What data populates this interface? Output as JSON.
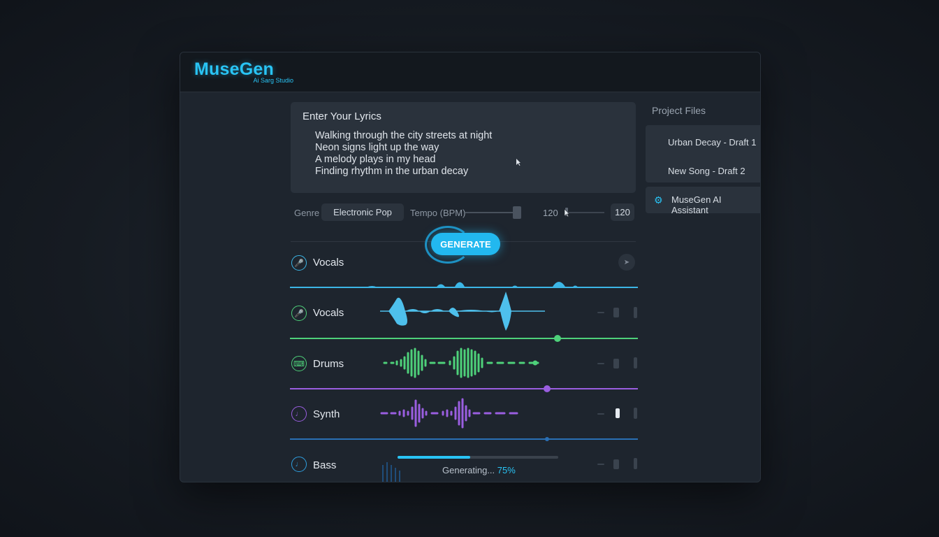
{
  "app": {
    "name": "MuseGen",
    "subtitle": "Ai Sarg Studio"
  },
  "lyrics": {
    "title": "Enter Your Lyrics",
    "lines": [
      "Walking through the city streets at night",
      "Neon signs light up the way",
      "A melody plays in my head",
      "Finding rhythm in the urban decay"
    ]
  },
  "controls": {
    "genre_label": "Genre",
    "genre_value": "Electronic Pop",
    "tempo_label": "Tempo (BPM)",
    "tempo_value": "120",
    "tempo_box": "120",
    "generate_label": "GENERATE"
  },
  "tracks": [
    {
      "name": "Vocals",
      "icon": "microphone-icon",
      "color": "#3cb6e6"
    },
    {
      "name": "Vocals",
      "icon": "microphone-icon",
      "color": "#4ed17a"
    },
    {
      "name": "Drums",
      "icon": "keyboard-icon",
      "color": "#4ed17a"
    },
    {
      "name": "Synth",
      "icon": "guitar-icon",
      "color": "#9a5ee0"
    },
    {
      "name": "Bass",
      "icon": "guitar-icon",
      "color": "#2f9fe0"
    }
  ],
  "progress": {
    "label": "Generating...",
    "percent_text": "75%",
    "value": 0.45
  },
  "sidebar": {
    "title": "Project Files",
    "files": [
      "Urban Decay - Draft 1",
      "New Song - Draft 2"
    ],
    "assistant_label": "MuseGen AI Assistant"
  },
  "colors": {
    "accent": "#29c4f5",
    "green": "#4ed17a",
    "purple": "#9a5ee0",
    "panel": "#2a323c"
  }
}
